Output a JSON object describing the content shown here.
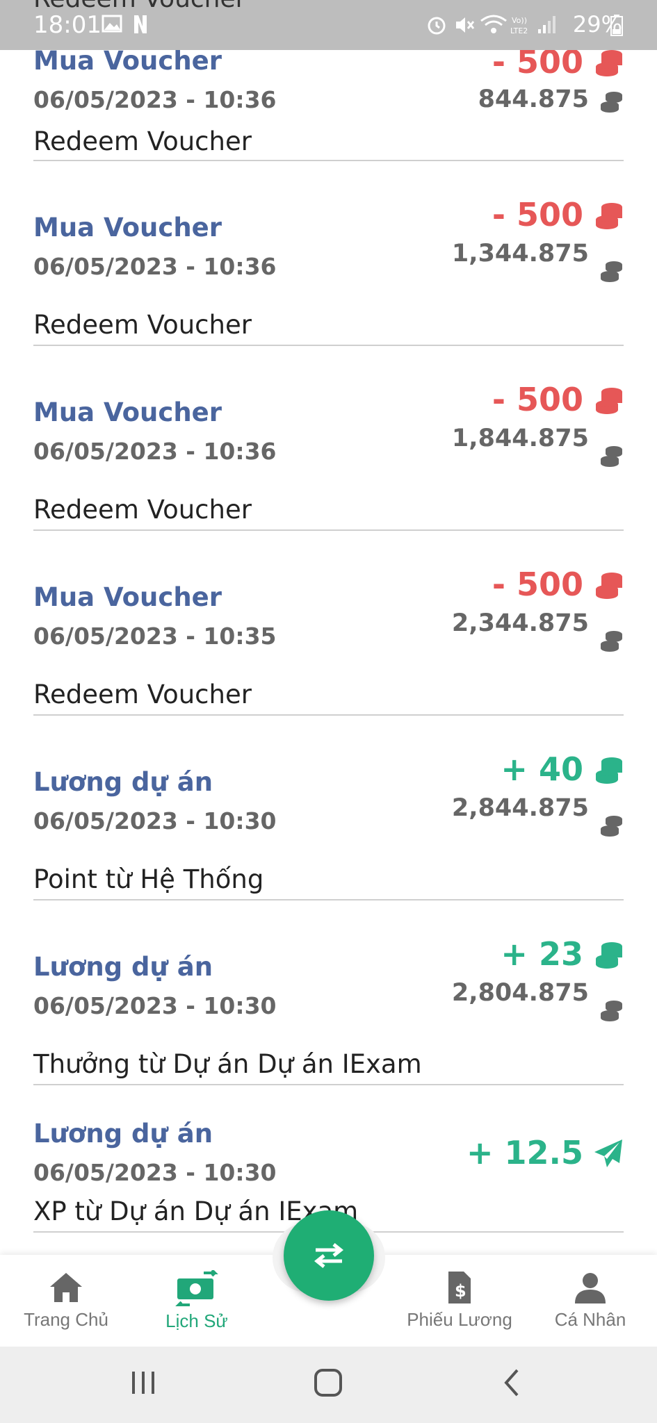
{
  "status_bar": {
    "time": "18:01",
    "battery": "29%",
    "peek_text": "Redeem Voucher",
    "icons": [
      "image-icon",
      "n-app-icon",
      "alarm-icon",
      "mute-icon",
      "wifi-icon",
      "volte-icon",
      "signal-icon",
      "battery-icon"
    ]
  },
  "transactions": [
    {
      "title": "Mua Voucher",
      "date": "06/05/2023 - 10:36",
      "description": "Redeem Voucher",
      "amount": "- 500",
      "amount_type": "negative",
      "amount_icon": "coin-stack-icon",
      "balance": "844.875",
      "balance_icon": "coin-stack-icon"
    },
    {
      "title": "Mua Voucher",
      "date": "06/05/2023 - 10:36",
      "description": "Redeem Voucher",
      "amount": "- 500",
      "amount_type": "negative",
      "amount_icon": "coin-stack-icon",
      "balance": "1,344.875",
      "balance_icon": "coin-stack-icon"
    },
    {
      "title": "Mua Voucher",
      "date": "06/05/2023 - 10:36",
      "description": "Redeem Voucher",
      "amount": "- 500",
      "amount_type": "negative",
      "amount_icon": "coin-stack-icon",
      "balance": "1,844.875",
      "balance_icon": "coin-stack-icon"
    },
    {
      "title": "Mua Voucher",
      "date": "06/05/2023 - 10:35",
      "description": "Redeem Voucher",
      "amount": "- 500",
      "amount_type": "negative",
      "amount_icon": "coin-stack-icon",
      "balance": "2,344.875",
      "balance_icon": "coin-stack-icon"
    },
    {
      "title": "Lương dự án",
      "date": "06/05/2023 - 10:30",
      "description": "Point từ Hệ Thống",
      "amount": "+ 40",
      "amount_type": "positive",
      "amount_icon": "coin-stack-icon",
      "balance": "2,844.875",
      "balance_icon": "coin-stack-icon"
    },
    {
      "title": "Lương dự án",
      "date": "06/05/2023 - 10:30",
      "description": "Thưởng từ Dự án Dự án IExam",
      "amount": "+ 23",
      "amount_type": "positive",
      "amount_icon": "coin-stack-icon",
      "balance": "2,804.875",
      "balance_icon": "coin-stack-icon"
    },
    {
      "title": "Lương dự án",
      "date": "06/05/2023 - 10:30",
      "description": "XP từ Dự án Dự án IExam",
      "amount": "+ 12.5",
      "amount_type": "positive",
      "amount_icon": "paper-plane-icon",
      "balance": "",
      "balance_icon": ""
    }
  ],
  "bottom_nav": {
    "items": [
      {
        "label": "Trang Chủ",
        "icon": "home-icon",
        "active": false
      },
      {
        "label": "Lịch Sử",
        "icon": "money-transfer-icon",
        "active": true
      },
      {
        "label": "Phiếu Lương",
        "icon": "payslip-icon",
        "active": false
      },
      {
        "label": "Cá Nhân",
        "icon": "person-icon",
        "active": false
      }
    ],
    "fab_icon": "swap-arrows-icon"
  },
  "system_nav": {
    "icons": [
      "recent-apps-icon",
      "home-button-icon",
      "back-icon"
    ]
  },
  "colors": {
    "title": "#4a659e",
    "negative": "#e65757",
    "positive": "#2bb38a",
    "balance": "#666666",
    "active_nav": "#21a779",
    "fab": "#1fae74",
    "status_bar": "#bdbdbd"
  }
}
